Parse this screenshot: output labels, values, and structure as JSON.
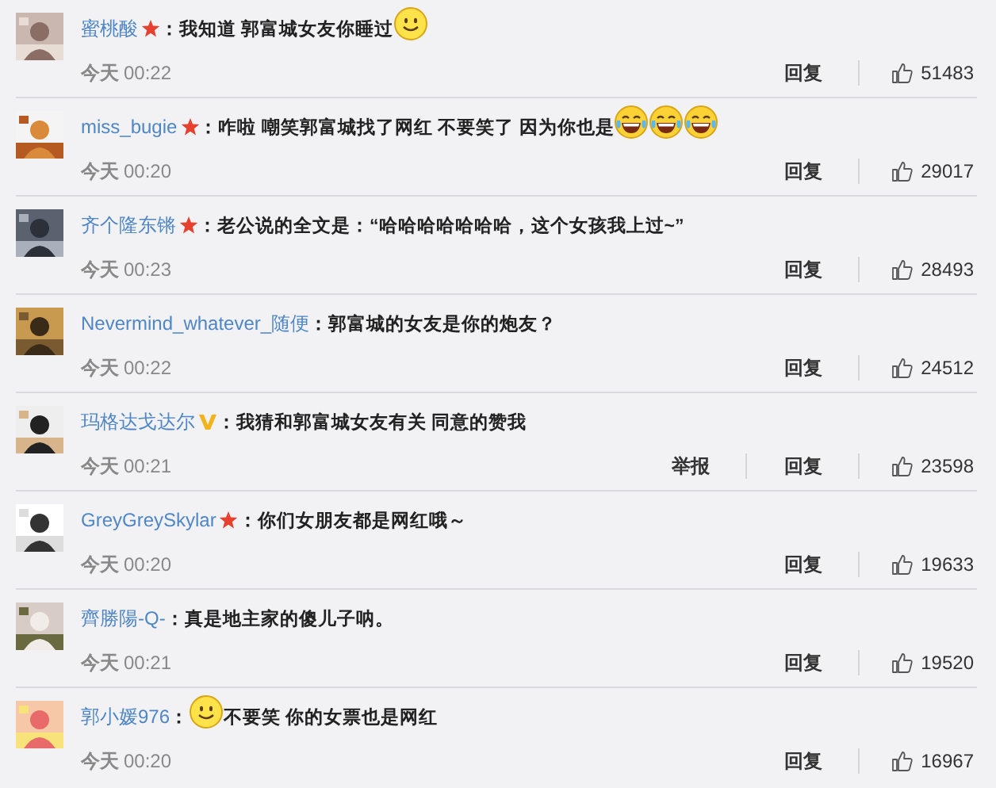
{
  "comments": [
    {
      "name": "蜜桃酸",
      "star_badge": true,
      "vip_badge": false,
      "parts": [
        {
          "kind": "text",
          "text": "：我知道 郭富城女友你睡过"
        },
        {
          "kind": "smile"
        }
      ],
      "day": "今天",
      "time": "00:22",
      "actions": [
        "回复"
      ],
      "likes": "51483"
    },
    {
      "name": "miss_bugie",
      "star_badge": true,
      "vip_badge": false,
      "parts": [
        {
          "kind": "text",
          "text": "：咋啦 嘲笑郭富城找了网红 不要笑了 因为你也是"
        },
        {
          "kind": "laugh"
        },
        {
          "kind": "laugh"
        },
        {
          "kind": "laugh"
        }
      ],
      "day": "今天",
      "time": "00:20",
      "actions": [
        "回复"
      ],
      "likes": "29017"
    },
    {
      "name": "齐个隆东锵",
      "star_badge": true,
      "vip_badge": false,
      "parts": [
        {
          "kind": "text",
          "text": "：老公说的全文是：“哈哈哈哈哈哈哈，这个女孩我上过~”"
        }
      ],
      "day": "今天",
      "time": "00:23",
      "actions": [
        "回复"
      ],
      "likes": "28493"
    },
    {
      "name": "Nevermind_whatever_随便",
      "star_badge": false,
      "vip_badge": false,
      "parts": [
        {
          "kind": "text",
          "text": "：郭富城的女友是你的炮友？"
        }
      ],
      "day": "今天",
      "time": "00:22",
      "actions": [
        "回复"
      ],
      "likes": "24512"
    },
    {
      "name": "玛格达戈达尔",
      "star_badge": false,
      "vip_badge": true,
      "parts": [
        {
          "kind": "text",
          "text": "：我猜和郭富城女友有关 同意的赞我"
        }
      ],
      "day": "今天",
      "time": "00:21",
      "actions": [
        "举报",
        "回复"
      ],
      "likes": "23598"
    },
    {
      "name": "GreyGreySkylar",
      "star_badge": true,
      "vip_badge": false,
      "parts": [
        {
          "kind": "text",
          "text": "：你们女朋友都是网红哦～"
        }
      ],
      "day": "今天",
      "time": "00:20",
      "actions": [
        "回复"
      ],
      "likes": "19633"
    },
    {
      "name": "齊勝陽-Q-",
      "star_badge": false,
      "vip_badge": false,
      "parts": [
        {
          "kind": "text",
          "text": "：真是地主家的傻儿子呐。"
        }
      ],
      "day": "今天",
      "time": "00:21",
      "actions": [
        "回复"
      ],
      "likes": "19520"
    },
    {
      "name": "郭小媛976",
      "star_badge": false,
      "vip_badge": false,
      "parts": [
        {
          "kind": "text",
          "text": "："
        },
        {
          "kind": "smile"
        },
        {
          "kind": "text",
          "text": "不要笑 你的女票也是网红"
        }
      ],
      "day": "今天",
      "time": "00:20",
      "actions": [
        "回复"
      ],
      "likes": "16967"
    }
  ]
}
